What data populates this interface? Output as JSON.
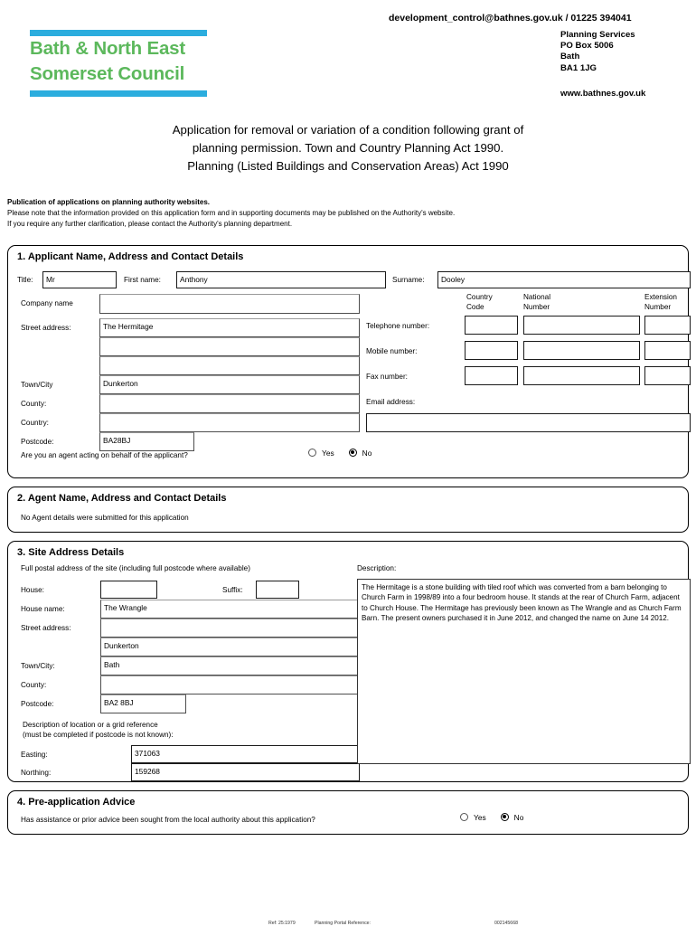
{
  "header": {
    "logo_line1": "Bath & North East",
    "logo_line2": "Somerset Council",
    "logo_bar_color": "#2badde",
    "logo_text_color": "#5cb85c",
    "contact": "development_control@bathnes.gov.uk / 01225 394041",
    "address": [
      "Planning Services",
      "PO Box 5006",
      "Bath",
      "BA1 1JG"
    ],
    "website": "www.bathnes.gov.uk"
  },
  "title": {
    "line1": "Application for removal or variation of a condition following grant of",
    "line2": "planning permission. Town and Country Planning Act 1990.",
    "line3": "Planning (Listed Buildings and Conservation Areas) Act 1990"
  },
  "publication_note": {
    "heading": "Publication of applications on planning authority websites.",
    "line1": "Please note that the information provided on this application form and in supporting documents may be published on the Authority's website.",
    "line2": "If you require any further clarification, please contact the Authority's planning department."
  },
  "section1": {
    "title": "1.  Applicant Name, Address and Contact Details",
    "labels": {
      "title": "Title:",
      "first_name": "First name:",
      "surname": "Surname:",
      "company_name": "Company name",
      "street_address": "Street address:",
      "town_city": "Town/City",
      "county": "County:",
      "country": "Country:",
      "postcode": "Postcode:",
      "telephone": "Telephone number:",
      "mobile": "Mobile number:",
      "fax": "Fax number:",
      "email": "Email address:",
      "country_code": "Country\nCode",
      "country_code_l1": "Country",
      "country_code_l2": "Code",
      "national_number_l1": "National",
      "national_number_l2": "Number",
      "extension_number_l1": "Extension",
      "extension_number_l2": "Number",
      "agent_question": "Are you an agent acting on behalf of the applicant?"
    },
    "values": {
      "title": "Mr",
      "first_name": "Anthony",
      "surname": "Dooley",
      "company_name": "",
      "street_address_1": "The Hermitage",
      "street_address_2": "",
      "street_address_3": "",
      "town_city": "Dunkerton",
      "county": "",
      "country": "",
      "postcode": "BA28BJ",
      "telephone_country_code": "",
      "telephone_national": "",
      "telephone_extension": "",
      "mobile_country_code": "",
      "mobile_national": "",
      "mobile_extension": "",
      "fax_country_code": "",
      "fax_national": "",
      "fax_extension": "",
      "email": ""
    },
    "agent_radio": {
      "yes_label": "Yes",
      "no_label": "No",
      "selected": "No"
    }
  },
  "section2": {
    "title": "2.  Agent Name, Address and Contact Details",
    "body": "No Agent details were submitted for this application"
  },
  "section3": {
    "title": "3.  Site Address Details",
    "subtitle": "Full postal address of the site (including full postcode where available)",
    "description_label": "Description:",
    "labels": {
      "house": "House:",
      "suffix": "Suffix:",
      "house_name": "House name:",
      "street_address": "Street address:",
      "town_city": "Town/City:",
      "county": "County:",
      "postcode": "Postcode:",
      "grid_line1": "Description of location or a grid reference",
      "grid_line2": "(must be completed if postcode is not known):",
      "easting": "Easting:",
      "northing": "Northing:"
    },
    "values": {
      "house": "",
      "suffix": "",
      "house_name": "The Wrangle",
      "street_address_1": "",
      "street_address_2": "Dunkerton",
      "town_city": "Bath",
      "county": "",
      "postcode": "BA2 8BJ",
      "easting": "371063",
      "northing": "159268",
      "description": "The Hermitage is a stone building with tiled roof which was converted from a barn belonging to Church Farm in 1998/89 into a four bedroom house. It stands at the rear of Church Farm, adjacent to Church House.  The Hermitage has previously been known as The Wrangle and as Church Farm Barn. The present owners purchased it in June 2012, and changed the name on June 14 2012."
    }
  },
  "section4": {
    "title": "4.  Pre-application Advice",
    "question": "Has assistance or prior advice been sought from the local authority about this application?",
    "radio": {
      "yes_label": "Yes",
      "no_label": "No",
      "selected": "No"
    }
  },
  "footer": {
    "ref": "Ref: 25:1979",
    "portal_label": "Planning Portal Reference:",
    "portal_value": "002145668"
  }
}
